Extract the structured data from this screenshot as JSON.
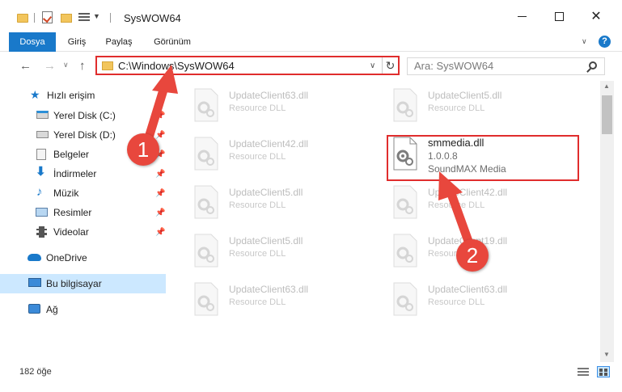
{
  "window": {
    "title": "SysWOW64"
  },
  "ribbon": {
    "tabs": [
      "Dosya",
      "Giriş",
      "Paylaş",
      "Görünüm"
    ],
    "help": "?"
  },
  "address_bar": {
    "path": "C:\\Windows\\SysWOW64",
    "refresh": "↻"
  },
  "search": {
    "placeholder": "Ara: SysWOW64"
  },
  "sidebar": {
    "items": [
      {
        "label": "Hızlı erişim",
        "icon": "star-icon"
      },
      {
        "label": "Yerel Disk (C:)",
        "icon": "drive-icon"
      },
      {
        "label": "Yerel Disk (D:)",
        "icon": "drive-icon"
      },
      {
        "label": "Belgeler",
        "icon": "documents-icon"
      },
      {
        "label": "İndirmeler",
        "icon": "download-icon"
      },
      {
        "label": "Müzik",
        "icon": "music-icon"
      },
      {
        "label": "Resimler",
        "icon": "pictures-icon"
      },
      {
        "label": "Videolar",
        "icon": "video-icon"
      },
      {
        "label": "OneDrive",
        "icon": "cloud-icon"
      },
      {
        "label": "Bu bilgisayar",
        "icon": "computer-icon"
      },
      {
        "label": "Ağ",
        "icon": "network-icon"
      }
    ]
  },
  "files": [
    {
      "name": "UpdateClient63.dll",
      "desc": "Resource DLL"
    },
    {
      "name": "UpdateClient5.dll",
      "desc": "Resource DLL"
    },
    {
      "name": "UpdateClient42.dll",
      "desc": "Resource DLL"
    },
    {
      "name": "smmedia.dll",
      "desc": "1.0.0.8",
      "desc2": "SoundMAX Media"
    },
    {
      "name": "UpdateClient5.dll",
      "desc": "Resource DLL"
    },
    {
      "name": "UpdateClient42.dll",
      "desc": "Resource DLL"
    },
    {
      "name": "UpdateClient5.dll",
      "desc": "Resource DLL"
    },
    {
      "name": "UpdateClient19.dll",
      "desc": "Resource DLL"
    },
    {
      "name": "UpdateClient63.dll",
      "desc": "Resource DLL"
    },
    {
      "name": "UpdateClient63.dll",
      "desc": "Resource DLL"
    }
  ],
  "status": {
    "count": "182 öğe"
  },
  "annotations": {
    "step1": "1",
    "step2": "2",
    "color": "#e8473d"
  },
  "colors": {
    "accent": "#1979ca",
    "highlight": "#e02d2d",
    "selected": "#cce8ff"
  }
}
